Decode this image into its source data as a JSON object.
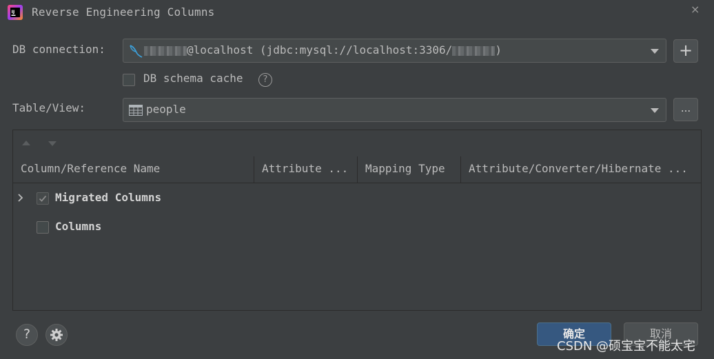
{
  "window": {
    "title": "Reverse Engineering Columns",
    "close_glyph": "×",
    "app_icon": "intellij-idea-icon"
  },
  "db_connection": {
    "label": "DB connection:",
    "value_host": "@localhost (jdbc:mysql://localhost:3306/",
    "value_end": ")",
    "add_glyph": "+",
    "icon": "mysql-dolphin-icon"
  },
  "schema_cache": {
    "label": "DB schema cache",
    "checked": false,
    "help_glyph": "?"
  },
  "table_view": {
    "label": "Table/View:",
    "value": "people",
    "more_glyph": "...",
    "icon": "table-icon"
  },
  "table": {
    "columns": [
      "Column/Reference Name",
      "Attribute ...",
      "Mapping Type",
      "Attribute/Converter/Hibernate ..."
    ],
    "rows": [
      {
        "label": "Migrated Columns",
        "checked": true,
        "expandable": true,
        "expander_glyph": "›"
      },
      {
        "label": "Columns",
        "checked": false,
        "expandable": false
      }
    ]
  },
  "footer": {
    "help_glyph": "?",
    "ok_label": "确定",
    "cancel_label": "取消"
  },
  "watermark": "CSDN @硕宝宝不能太宅",
  "colors": {
    "background": "#3c3f41",
    "primary_button": "#365880",
    "text": "#bbbbbb"
  }
}
